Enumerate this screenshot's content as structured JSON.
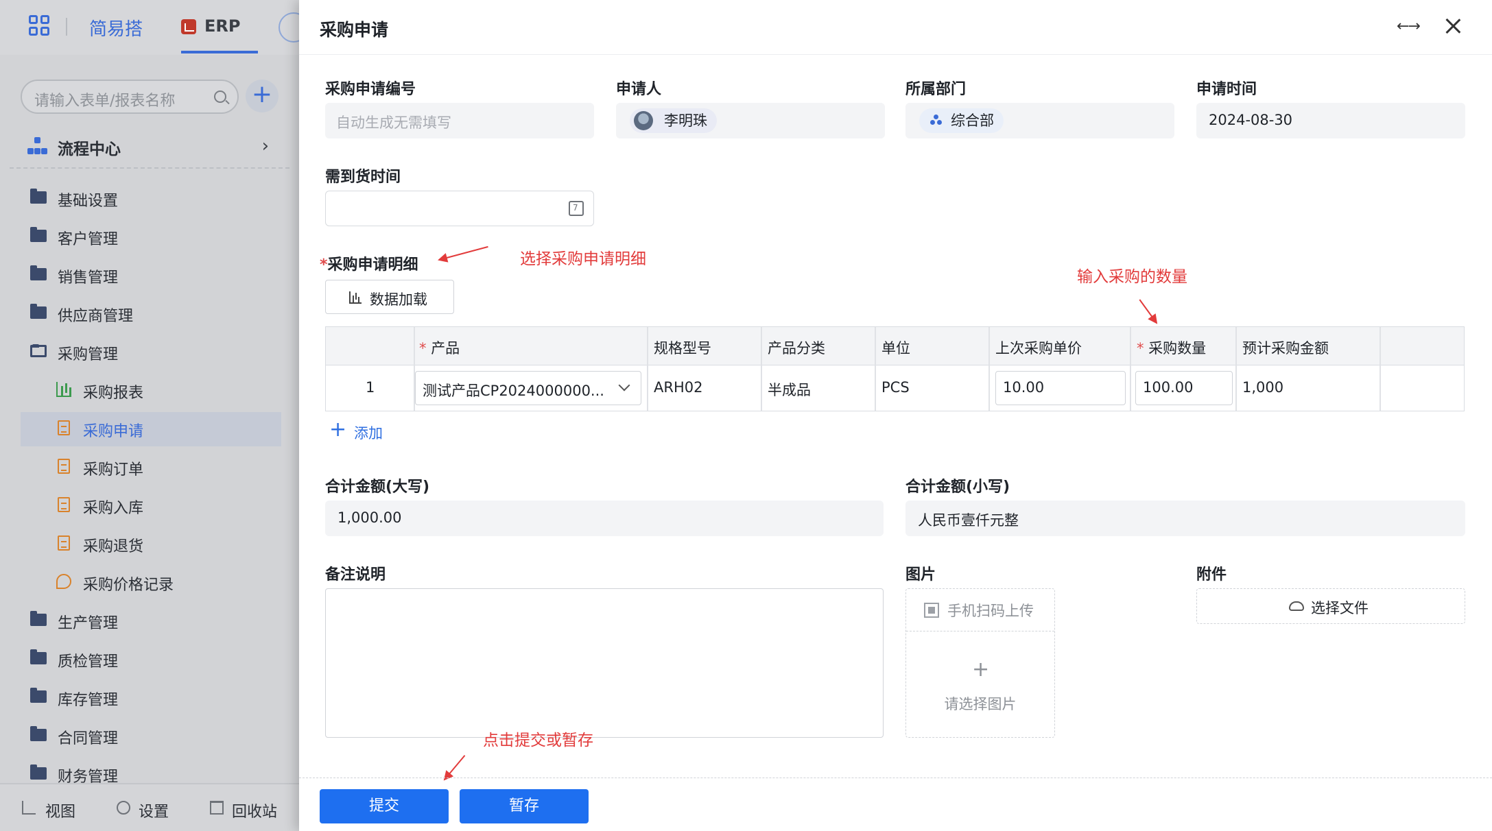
{
  "sidebar": {
    "brand": "简易搭",
    "app_tab": "ERP",
    "search_placeholder": "请输入表单/报表名称",
    "flow_center": "流程中心",
    "menu": [
      {
        "label": "基础设置"
      },
      {
        "label": "客户管理"
      },
      {
        "label": "销售管理"
      },
      {
        "label": "供应商管理"
      },
      {
        "label": "采购管理"
      },
      {
        "label": "采购报表"
      },
      {
        "label": "采购申请"
      },
      {
        "label": "采购订单"
      },
      {
        "label": "采购入库"
      },
      {
        "label": "采购退货"
      },
      {
        "label": "采购价格记录"
      },
      {
        "label": "生产管理"
      },
      {
        "label": "质检管理"
      },
      {
        "label": "库存管理"
      },
      {
        "label": "合同管理"
      },
      {
        "label": "财务管理"
      }
    ],
    "bottom": {
      "view": "视图",
      "settings": "设置",
      "recycle": "回收站"
    }
  },
  "drawer": {
    "title": "采购申请",
    "fields": {
      "request_no": {
        "label": "采购申请编号",
        "placeholder": "自动生成无需填写"
      },
      "applicant": {
        "label": "申请人",
        "value": "李明珠"
      },
      "department": {
        "label": "所属部门",
        "value": "综合部"
      },
      "apply_time": {
        "label": "申请时间",
        "value": "2024-08-30"
      },
      "delivery_time": {
        "label": "需到货时间",
        "value": ""
      }
    },
    "detail": {
      "required_mark": "*",
      "label": "采购申请明细",
      "load_button": "数据加载",
      "columns": [
        "产品",
        "规格型号",
        "产品分类",
        "单位",
        "上次采购单价",
        "采购数量",
        "预计采购金额"
      ],
      "rows": [
        {
          "index": "1",
          "product": "测试产品CP2024000000...",
          "spec": "ARH02",
          "category": "半成品",
          "unit": "PCS",
          "last_price": "10.00",
          "quantity": "100.00",
          "amount": "1,000"
        }
      ],
      "add_label": "添加"
    },
    "total_upper": {
      "label": "合计金额(大写)",
      "value": "1,000.00"
    },
    "total_lower": {
      "label": "合计金额(小写)",
      "value": "人民币壹仟元整"
    },
    "remark": {
      "label": "备注说明"
    },
    "image": {
      "label": "图片",
      "scan": "手机扫码上传",
      "choose": "请选择图片"
    },
    "attachment": {
      "label": "附件",
      "choose_file": "选择文件"
    },
    "buttons": {
      "submit": "提交",
      "save_draft": "暂存"
    }
  },
  "annotations": {
    "select_detail": "选择采购申请明细",
    "enter_quantity": "输入采购的数量",
    "click_submit": "点击提交或暂存"
  },
  "colors": {
    "primary": "#1e6ff0",
    "annotation": "#e23b3b",
    "sidebar_accent": "#3a6bd6"
  }
}
